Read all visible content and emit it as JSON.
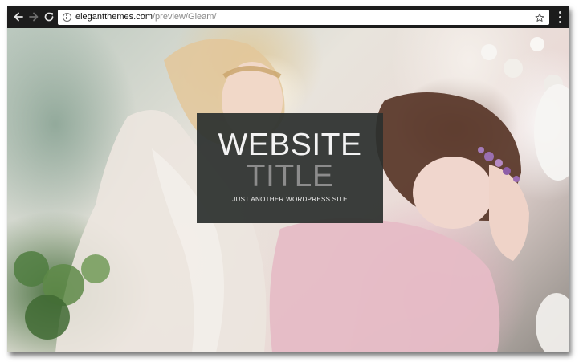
{
  "browser": {
    "url_domain": "elegantthemes.com",
    "url_path": "/preview/Gleam/",
    "icons": {
      "back": "arrow-left-icon",
      "forward": "arrow-right-icon",
      "reload": "reload-icon",
      "info": "info-icon",
      "bookmark": "star-icon",
      "menu": "kebab-menu-icon"
    },
    "colors": {
      "toolbar": "#1c1c1c",
      "omnibox": "#ffffff"
    }
  },
  "site": {
    "title_line_1": "WEBSITE",
    "title_line_2": "TITLE",
    "tagline": "JUST ANOTHER WORDPRESS SITE",
    "colors": {
      "title_box": "#2c302e",
      "title_primary": "#f3f3f3",
      "title_secondary": "#8c8c8c"
    }
  }
}
